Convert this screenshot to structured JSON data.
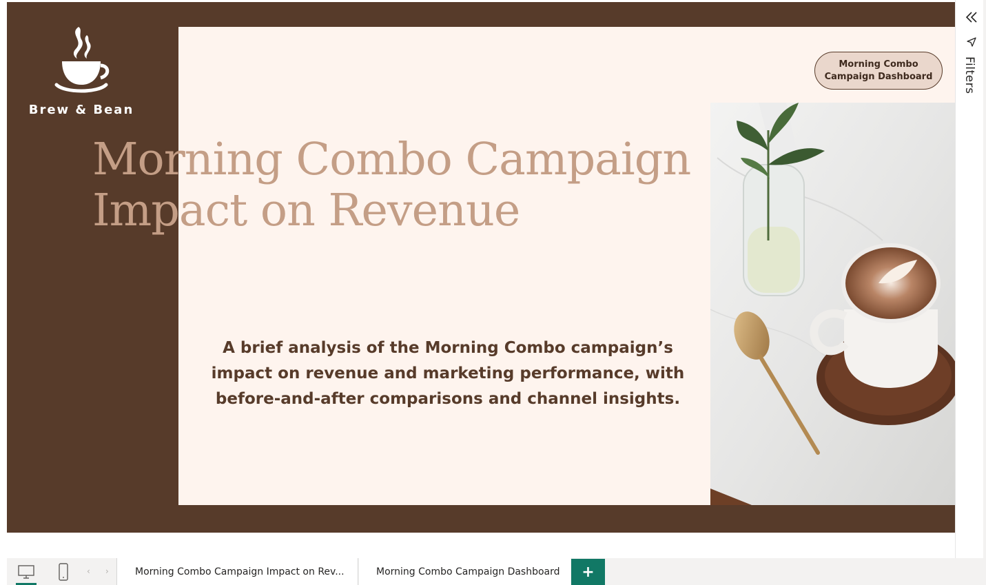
{
  "report": {
    "brand_name": "Brew & Bean",
    "title_line1": "Morning Combo Campaign",
    "title_line2": "Impact on Revenue",
    "subtitle": "A brief analysis of the Morning Combo campaign’s impact on revenue and marketing performance, with before-and-after comparisons and channel insights.",
    "nav_button_label": "Morning Combo Campaign Dashboard",
    "photo": "coffee-latte-art-photo",
    "colors": {
      "brown": "#573b2a",
      "cream": "#fef4ee",
      "title_tan": "#c49e86",
      "button_fill": "#ead7cc",
      "accent_green": "#117865"
    }
  },
  "filters_pane": {
    "label": "Filters",
    "collapse_icon": "double-chevron-left-icon",
    "filter_icon": "filter-funnel-icon"
  },
  "page_tabs": {
    "desktop_icon": "desktop-view-icon",
    "mobile_icon": "mobile-view-icon",
    "prev_arrow": "‹",
    "next_arrow": "›",
    "tabs": [
      {
        "label": "Morning Combo Campaign Impact on Rev...",
        "active": true
      },
      {
        "label": "Morning Combo Campaign Dashboard",
        "active": false
      }
    ],
    "add_label": "+"
  }
}
